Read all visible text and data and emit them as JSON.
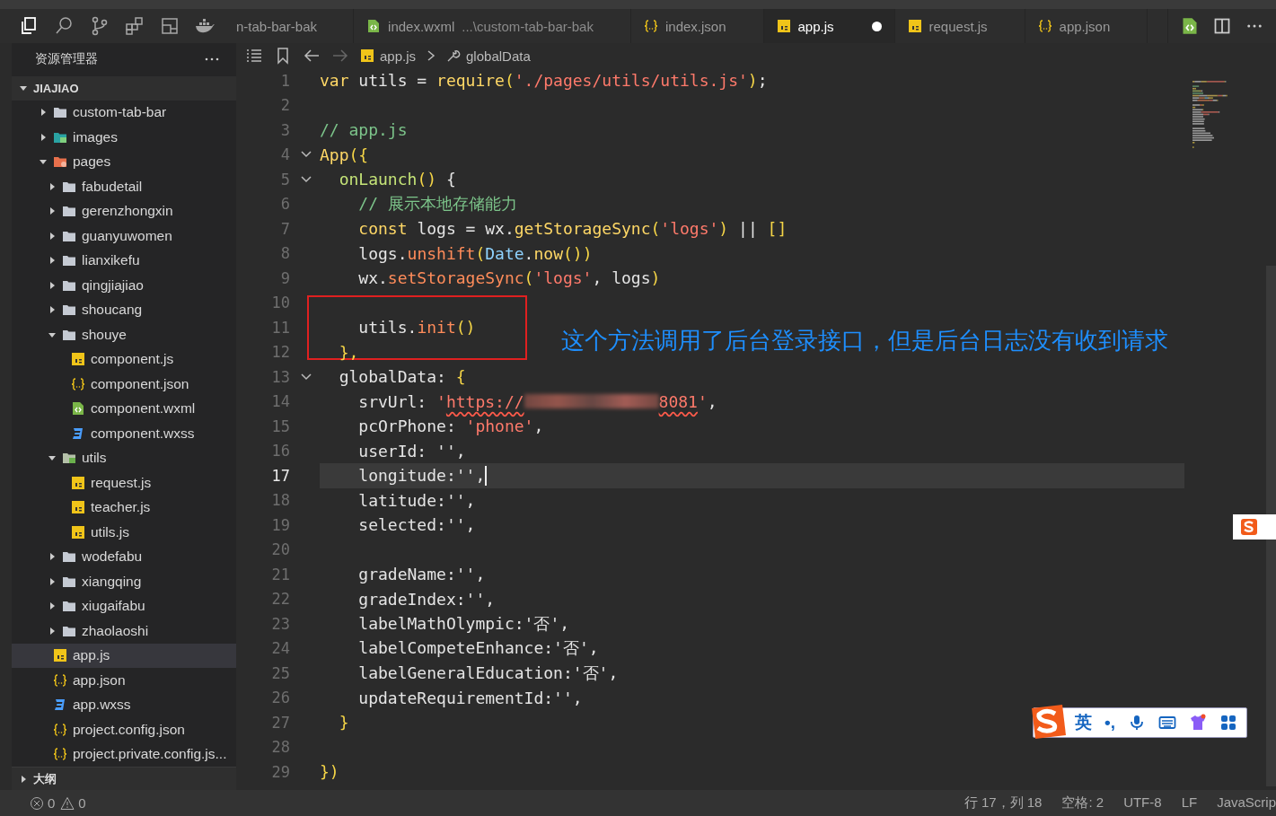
{
  "activity_bar": {
    "items": [
      {
        "kind": "files",
        "selected": true
      },
      {
        "kind": "search",
        "selected": false
      },
      {
        "kind": "branch",
        "selected": false
      },
      {
        "kind": "extensions",
        "selected": false
      },
      {
        "kind": "layout",
        "selected": false
      },
      {
        "kind": "whale",
        "selected": false
      }
    ]
  },
  "tabs": [
    {
      "label": "n-tab-bar-bak",
      "kind": "none",
      "selected": false,
      "modified": false
    },
    {
      "label": "index.wxml",
      "description": "...\\custom-tab-bar-bak",
      "kind": "wxml",
      "selected": false,
      "modified": false
    },
    {
      "label": "index.json",
      "kind": "json",
      "selected": false,
      "modified": false
    },
    {
      "label": "app.js",
      "kind": "js",
      "selected": true,
      "modified": true
    },
    {
      "label": "request.js",
      "kind": "js",
      "selected": false,
      "modified": false
    },
    {
      "label": "app.json",
      "kind": "json",
      "selected": false,
      "modified": false
    }
  ],
  "sidebar": {
    "title": "资源管理器",
    "section": "JIAJIAO",
    "outline": "大纲",
    "items": [
      {
        "label": "custom-tab-bar",
        "kind": "folder",
        "expanded": false,
        "selected": false
      },
      {
        "label": "images",
        "kind": "images-folder",
        "expanded": false,
        "selected": false
      },
      {
        "label": "pages",
        "kind": "pages-folder",
        "expanded": true,
        "selected": false,
        "children": [
          {
            "label": "fabudetail",
            "kind": "folder",
            "expanded": false,
            "selected": false
          },
          {
            "label": "gerenzhongxin",
            "kind": "folder",
            "expanded": false,
            "selected": false
          },
          {
            "label": "guanyuwomen",
            "kind": "folder",
            "expanded": false,
            "selected": false
          },
          {
            "label": "lianxikefu",
            "kind": "folder",
            "expanded": false,
            "selected": false
          },
          {
            "label": "qingjiajiao",
            "kind": "folder",
            "expanded": false,
            "selected": false
          },
          {
            "label": "shoucang",
            "kind": "folder",
            "expanded": false,
            "selected": false
          },
          {
            "label": "shouye",
            "kind": "folder",
            "expanded": true,
            "selected": false,
            "children": [
              {
                "label": "component.js",
                "kind": "js",
                "selected": false
              },
              {
                "label": "component.json",
                "kind": "json",
                "selected": false
              },
              {
                "label": "component.wxml",
                "kind": "wxml",
                "selected": false
              },
              {
                "label": "component.wxss",
                "kind": "wxss",
                "selected": false
              }
            ]
          },
          {
            "label": "utils",
            "kind": "utils-folder",
            "expanded": true,
            "selected": false,
            "children": [
              {
                "label": "request.js",
                "kind": "js",
                "selected": false
              },
              {
                "label": "teacher.js",
                "kind": "js",
                "selected": false
              },
              {
                "label": "utils.js",
                "kind": "js",
                "selected": false
              }
            ]
          },
          {
            "label": "wodefabu",
            "kind": "folder",
            "expanded": false,
            "selected": false
          },
          {
            "label": "xiangqing",
            "kind": "folder",
            "expanded": false,
            "selected": false
          },
          {
            "label": "xiugaifabu",
            "kind": "folder",
            "expanded": false,
            "selected": false
          },
          {
            "label": "zhaolaoshi",
            "kind": "folder",
            "expanded": false,
            "selected": false
          }
        ]
      },
      {
        "label": "app.js",
        "kind": "js",
        "selected": true
      },
      {
        "label": "app.json",
        "kind": "json",
        "selected": false
      },
      {
        "label": "app.wxss",
        "kind": "wxss",
        "selected": false
      },
      {
        "label": "project.config.json",
        "kind": "json",
        "selected": false
      },
      {
        "label": "project.private.config.js...",
        "kind": "json",
        "selected": false
      }
    ]
  },
  "breadcrumb": [
    {
      "label": "app.js",
      "kind": "js"
    },
    {
      "label": "globalData",
      "kind": "wrench"
    }
  ],
  "editor": {
    "lines": [
      {
        "number": "1",
        "fold": false,
        "current": false,
        "boxed": false,
        "tokens": [
          {
            "kind": "kw",
            "text": "var"
          },
          {
            "kind": "text",
            "text": " utils = "
          },
          {
            "kind": "fn",
            "text": "require"
          },
          {
            "kind": "bracket",
            "text": "("
          },
          {
            "kind": "str",
            "text": "'./pages/utils/utils.js'"
          },
          {
            "kind": "bracket",
            "text": ")"
          },
          {
            "kind": "text",
            "text": ";"
          }
        ]
      },
      {
        "number": "2",
        "fold": false,
        "current": false,
        "boxed": false
      },
      {
        "number": "3",
        "fold": false,
        "current": false,
        "boxed": false,
        "tokens": [
          {
            "kind": "comment",
            "text": "// app.js"
          }
        ]
      },
      {
        "number": "4",
        "fold": true,
        "current": false,
        "boxed": false,
        "tokens": [
          {
            "kind": "fn",
            "text": "App"
          },
          {
            "kind": "bracket",
            "text": "({"
          }
        ]
      },
      {
        "number": "5",
        "fold": true,
        "current": false,
        "boxed": false,
        "tokens": [
          {
            "kind": "method",
            "text": "  onLaunch"
          },
          {
            "kind": "bracket",
            "text": "()"
          },
          {
            "kind": "text",
            "text": " {"
          }
        ]
      },
      {
        "number": "6",
        "fold": false,
        "current": false,
        "boxed": false,
        "tokens": [
          {
            "kind": "comment",
            "text": "    // 展示本地存储能力"
          }
        ]
      },
      {
        "number": "7",
        "fold": false,
        "current": false,
        "boxed": false,
        "tokens": [
          {
            "kind": "kw",
            "text": "    const"
          },
          {
            "kind": "text",
            "text": " logs = wx."
          },
          {
            "kind": "fn",
            "text": "getStorageSync"
          },
          {
            "kind": "bracket",
            "text": "("
          },
          {
            "kind": "str",
            "text": "'logs'"
          },
          {
            "kind": "bracket",
            "text": ")"
          },
          {
            "kind": "text",
            "text": " || "
          },
          {
            "kind": "bracket",
            "text": "[]"
          }
        ]
      },
      {
        "number": "8",
        "fold": false,
        "current": false,
        "boxed": false,
        "tokens": [
          {
            "kind": "text",
            "text": "    logs."
          },
          {
            "kind": "call",
            "text": "unshift"
          },
          {
            "kind": "bracket",
            "text": "("
          },
          {
            "kind": "cls",
            "text": "Date"
          },
          {
            "kind": "text",
            "text": "."
          },
          {
            "kind": "fn",
            "text": "now"
          },
          {
            "kind": "bracket",
            "text": "())"
          }
        ]
      },
      {
        "number": "9",
        "fold": false,
        "current": false,
        "boxed": false,
        "tokens": [
          {
            "kind": "text",
            "text": "    wx."
          },
          {
            "kind": "call",
            "text": "setStorageSync"
          },
          {
            "kind": "bracket",
            "text": "("
          },
          {
            "kind": "str",
            "text": "'logs'"
          },
          {
            "kind": "text",
            "text": ", logs"
          },
          {
            "kind": "bracket",
            "text": ")"
          }
        ]
      },
      {
        "number": "10",
        "fold": false,
        "current": false,
        "boxed": false
      },
      {
        "number": "11",
        "fold": false,
        "current": false,
        "boxed": true,
        "tokens": [
          {
            "kind": "text",
            "text": "    utils."
          },
          {
            "kind": "call",
            "text": "init"
          },
          {
            "kind": "bracket",
            "text": "()"
          }
        ]
      },
      {
        "number": "12",
        "fold": false,
        "current": false,
        "boxed": false,
        "tokens": [
          {
            "kind": "bracket",
            "text": "  },"
          }
        ]
      },
      {
        "number": "13",
        "fold": true,
        "current": false,
        "boxed": false,
        "tokens": [
          {
            "kind": "text",
            "text": "  globalData: "
          },
          {
            "kind": "bracket",
            "text": "{"
          }
        ]
      },
      {
        "number": "14",
        "fold": false,
        "current": false,
        "boxed": false,
        "tokens": [
          {
            "kind": "text",
            "text": "    srvUrl: "
          },
          {
            "kind": "str",
            "text": "'"
          },
          {
            "kind": "url",
            "text": "https://",
            "tail": "8081"
          },
          {
            "kind": "str",
            "text": "'"
          },
          {
            "kind": "text",
            "text": ","
          }
        ]
      },
      {
        "number": "15",
        "fold": false,
        "current": false,
        "boxed": false,
        "tokens": [
          {
            "kind": "text",
            "text": "    pcOrPhone: "
          },
          {
            "kind": "str",
            "text": "'phone'"
          },
          {
            "kind": "text",
            "text": ","
          }
        ]
      },
      {
        "number": "16",
        "fold": false,
        "current": false,
        "boxed": false,
        "tokens": [
          {
            "kind": "text",
            "text": "    userId: '',"
          }
        ]
      },
      {
        "number": "17",
        "fold": false,
        "current": true,
        "boxed": false,
        "tokens": [
          {
            "kind": "text",
            "text": "    longitude:'',"
          }
        ]
      },
      {
        "number": "18",
        "fold": false,
        "current": false,
        "boxed": false,
        "tokens": [
          {
            "kind": "text",
            "text": "    latitude:'',"
          }
        ]
      },
      {
        "number": "19",
        "fold": false,
        "current": false,
        "boxed": false,
        "tokens": [
          {
            "kind": "text",
            "text": "    selected:'',"
          }
        ]
      },
      {
        "number": "20",
        "fold": false,
        "current": false,
        "boxed": false
      },
      {
        "number": "21",
        "fold": false,
        "current": false,
        "boxed": false,
        "tokens": [
          {
            "kind": "text",
            "text": "    gradeName:'',"
          }
        ]
      },
      {
        "number": "22",
        "fold": false,
        "current": false,
        "boxed": false,
        "tokens": [
          {
            "kind": "text",
            "text": "    gradeIndex:'',"
          }
        ]
      },
      {
        "number": "23",
        "fold": false,
        "current": false,
        "boxed": false,
        "tokens": [
          {
            "kind": "text",
            "text": "    labelMathOlympic:'否',"
          }
        ]
      },
      {
        "number": "24",
        "fold": false,
        "current": false,
        "boxed": false,
        "tokens": [
          {
            "kind": "text",
            "text": "    labelCompeteEnhance:'否',"
          }
        ]
      },
      {
        "number": "25",
        "fold": false,
        "current": false,
        "boxed": false,
        "tokens": [
          {
            "kind": "text",
            "text": "    labelGeneralEducation:'否',"
          }
        ]
      },
      {
        "number": "26",
        "fold": false,
        "current": false,
        "boxed": false,
        "tokens": [
          {
            "kind": "text",
            "text": "    updateRequirementId:'',"
          }
        ]
      },
      {
        "number": "27",
        "fold": false,
        "current": false,
        "boxed": false,
        "tokens": [
          {
            "kind": "bracket",
            "text": "  }"
          }
        ]
      },
      {
        "number": "28",
        "fold": false,
        "current": false,
        "boxed": false
      },
      {
        "number": "29",
        "fold": false,
        "current": false,
        "boxed": false,
        "tokens": [
          {
            "kind": "bracket",
            "text": "})"
          }
        ]
      }
    ],
    "annotation": "这个方法调用了后台登录接口，但是后台日志没有收到请求"
  },
  "ime_toolbar": {
    "items": [
      {
        "kind": "text",
        "text": "英"
      },
      {
        "kind": "text",
        "text": "•,"
      },
      {
        "kind": "mic"
      },
      {
        "kind": "keyboard"
      },
      {
        "kind": "shirt"
      },
      {
        "kind": "grid"
      }
    ]
  },
  "status_bar": {
    "errors": "0",
    "warnings": "0",
    "right": [
      "行 17，列 18",
      "空格: 2",
      "UTF-8",
      "LF",
      "JavaScrip"
    ]
  }
}
